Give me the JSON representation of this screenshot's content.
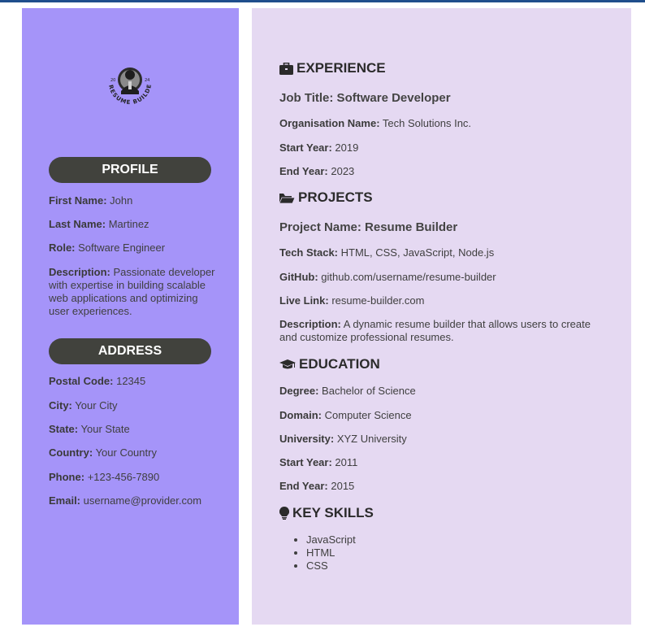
{
  "logo": {
    "text": "RESUME BUILDER",
    "year_left": "20",
    "year_right": "24"
  },
  "profile": {
    "heading": "PROFILE",
    "first_name_label": "First Name:",
    "first_name": "John",
    "last_name_label": "Last Name:",
    "last_name": "Martinez",
    "role_label": "Role:",
    "role": "Software Engineer",
    "description_label": "Description:",
    "description": "Passionate developer with expertise in building scalable web applications and optimizing user experiences."
  },
  "address": {
    "heading": "ADDRESS",
    "postal_label": "Postal Code:",
    "postal": "12345",
    "city_label": "City:",
    "city": "Your City",
    "state_label": "State:",
    "state": "Your State",
    "country_label": "Country:",
    "country": "Your Country",
    "phone_label": "Phone:",
    "phone": "+123-456-7890",
    "email_label": "Email:",
    "email": "username@provider.com"
  },
  "experience": {
    "heading": "EXPERIENCE",
    "icon": "briefcase-icon",
    "job_title": "Job Title: Software Developer",
    "org_label": "Organisation Name:",
    "org": "Tech Solutions Inc.",
    "start_label": "Start Year:",
    "start": "2019",
    "end_label": "End Year:",
    "end": "2023"
  },
  "projects": {
    "heading": "PROJECTS",
    "icon": "folder-open-icon",
    "project_name": "Project Name: Resume Builder",
    "tech_label": "Tech Stack:",
    "tech": "HTML, CSS, JavaScript, Node.js",
    "github_label": "GitHub:",
    "github": "github.com/username/resume-builder",
    "live_label": "Live Link:",
    "live": "resume-builder.com",
    "description_label": "Description:",
    "description": "A dynamic resume builder that allows users to create and customize professional resumes."
  },
  "education": {
    "heading": "EDUCATION",
    "icon": "graduation-cap-icon",
    "degree_label": "Degree:",
    "degree": "Bachelor of Science",
    "domain_label": "Domain:",
    "domain": "Computer Science",
    "university_label": "University:",
    "university": "XYZ University",
    "start_label": "Start Year:",
    "start": "2011",
    "end_label": "End Year:",
    "end": "2015"
  },
  "skills": {
    "heading": "KEY SKILLS",
    "icon": "lightbulb-icon",
    "items": [
      "JavaScript",
      "HTML",
      "CSS"
    ]
  },
  "colors": {
    "sidebar_bg": "#a594f9",
    "main_bg": "#e5d9f2",
    "pill_bg": "#41423d",
    "top_bar": "#1f4e8c"
  }
}
